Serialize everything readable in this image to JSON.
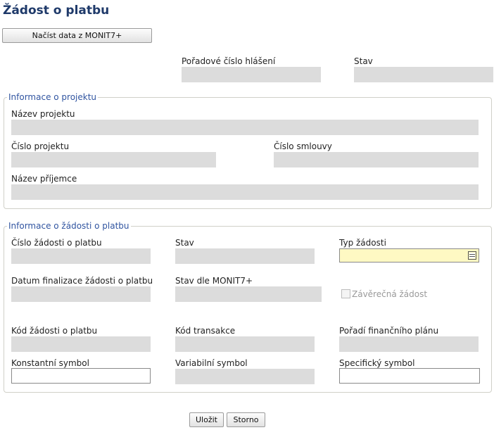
{
  "page": {
    "title": "Žádost o platbu",
    "load_button": "Načíst data z MONIT7+"
  },
  "header_fields": {
    "order_number_label": "Pořadové číslo hlášení",
    "status_label": "Stav"
  },
  "project": {
    "legend": "Informace o projektu",
    "name_label": "Název projektu",
    "number_label": "Číslo projektu",
    "contract_label": "Číslo smlouvy",
    "recipient_label": "Název příjemce"
  },
  "request": {
    "legend": "Informace o žádosti o platbu",
    "request_number_label": "Číslo žádosti o platbu",
    "status_label": "Stav",
    "type_label": "Typ žádosti",
    "finalization_date_label": "Datum finalizace žádosti o platbu",
    "monit_status_label": "Stav dle MONIT7+",
    "final_request_label": "Závěrečná žádost",
    "request_code_label": "Kód žádosti o platbu",
    "transaction_code_label": "Kód transakce",
    "plan_order_label": "Pořadí finančního plánu",
    "constant_symbol_label": "Konstantní symbol",
    "variable_symbol_label": "Variabilní symbol",
    "specific_symbol_label": "Specifický symbol",
    "type_value": "",
    "constant_symbol_value": "",
    "specific_symbol_value": ""
  },
  "actions": {
    "save": "Uložit",
    "cancel": "Storno"
  },
  "colors": {
    "title": "#1f3a6a",
    "legend": "#3054a0",
    "readonly_field": "#dcdcdc",
    "select_field": "#fef9c3"
  }
}
